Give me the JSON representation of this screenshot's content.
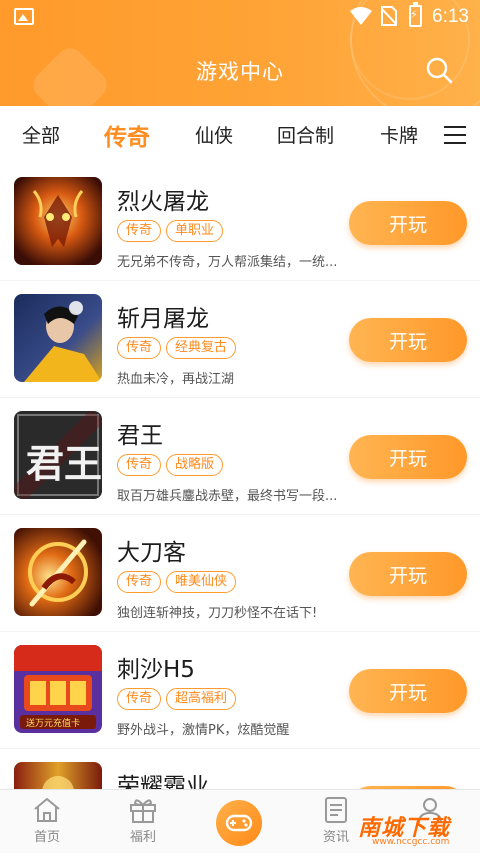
{
  "status_bar": {
    "time": "6:13"
  },
  "header": {
    "title": "游戏中心"
  },
  "tabs": [
    "全部",
    "传奇",
    "仙侠",
    "回合制",
    "卡牌"
  ],
  "active_tab": "传奇",
  "games": [
    {
      "name": "烈火屠龙",
      "tags": [
        "传奇",
        "单职业"
      ],
      "desc": "无兄弟不传奇，万人帮派集结，一统...",
      "button": "开玩"
    },
    {
      "name": "斩月屠龙",
      "tags": [
        "传奇",
        "经典复古"
      ],
      "desc": "热血未冷，再战江湖",
      "button": "开玩"
    },
    {
      "name": "君王",
      "tags": [
        "传奇",
        "战略版"
      ],
      "desc": "取百万雄兵鏖战赤壁，最终书写一段...",
      "button": "开玩"
    },
    {
      "name": "大刀客",
      "tags": [
        "传奇",
        "唯美仙侠"
      ],
      "desc": "独创连斩神技，刀刀秒怪不在话下!",
      "button": "开玩"
    },
    {
      "name": "刺沙H5",
      "tags": [
        "传奇",
        "超高福利"
      ],
      "desc": "野外战斗，激情PK，炫酷觉醒",
      "button": "开玩"
    },
    {
      "name": "荣耀霸业",
      "tags": [],
      "desc": "",
      "button": "开玩"
    }
  ],
  "icon_texts": {
    "junwang": "君王",
    "cisha": "送万元充值卡"
  },
  "bottom_nav": [
    {
      "label": "首页",
      "icon": "home-icon"
    },
    {
      "label": "福利",
      "icon": "gift-icon"
    },
    {
      "label": "",
      "icon": "gamepad-icon"
    },
    {
      "label": "资讯",
      "icon": "news-icon"
    },
    {
      "label": "",
      "icon": "user-icon"
    }
  ],
  "watermark": {
    "text": "南城下载",
    "url": "www.nccgcc.com"
  },
  "colors": {
    "accent": "#ff9a2b",
    "tag": "#ff8a1c"
  }
}
